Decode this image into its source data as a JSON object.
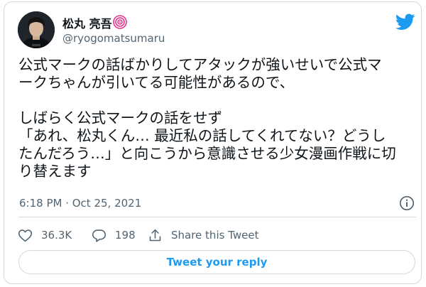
{
  "author": {
    "display_name": "松丸 亮吾",
    "handle": "@ryogomatsumaru"
  },
  "tweet": {
    "text": "公式マークの話ばかりしてアタックが強いせいで公式マ\nークちゃんが引いてる可能性があるので、\n\nしばらく公式マークの話をせず\n「あれ、松丸くん… 最近私の話してくれてない？どうし\nたんだろう…」と向こうから意識させる少女漫画作戦に切\nり替えます",
    "timestamp": "6:18 PM · Oct 25, 2021"
  },
  "actions": {
    "like_count": "36.3K",
    "reply_count": "198",
    "share_label": "Share this Tweet"
  },
  "reply_button_label": "Tweet your reply",
  "icons": {
    "badge": "spiral-badge-icon",
    "logo": "twitter-logo-icon",
    "info": "info-icon",
    "like": "heart-icon",
    "reply": "speech-bubble-icon",
    "share": "share-icon"
  },
  "colors": {
    "twitter_blue": "#1d9bf0",
    "text_primary": "#0f1419",
    "text_secondary": "#536471",
    "border": "#cfd9de",
    "badge_pink": "#e0378b"
  }
}
